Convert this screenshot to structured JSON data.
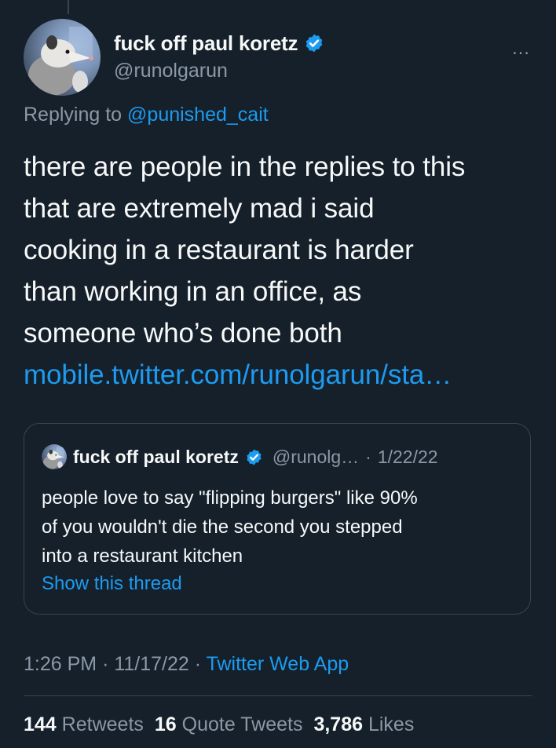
{
  "author": {
    "display_name": "fuck off paul koretz",
    "handle": "@runolgarun",
    "verified": true,
    "avatar_icon": "opossum-avatar"
  },
  "more_icon": "…",
  "replying_to": {
    "prefix": "Replying to",
    "mention": "@punished_cait"
  },
  "tweet": {
    "lines": [
      "there are people in the replies to this",
      "that are extremely mad i said",
      "cooking in a restaurant is harder",
      "than working in an office, as",
      "someone who’s done both"
    ],
    "link": "mobile.twitter.com/runolgarun/sta…"
  },
  "quote_tweet": {
    "display_name": "fuck off paul koretz",
    "handle": "@runolg…",
    "separator": "·",
    "date": "1/22/22",
    "lines": [
      "people love to say \"flipping burgers\" like 90%",
      "of you wouldn't die the second you stepped",
      "into a restaurant kitchen"
    ],
    "show_thread": "Show this thread"
  },
  "meta": {
    "time": "1:26 PM",
    "date": "11/17/22",
    "source": "Twitter Web App",
    "separator": "·"
  },
  "stats": {
    "retweets_count": "144",
    "retweets_label": "Retweets",
    "quotes_count": "16",
    "quotes_label": "Quote Tweets",
    "likes_count": "3,786",
    "likes_label": "Likes"
  },
  "colors": {
    "background": "#15202b",
    "text": "#f7f9f9",
    "secondary": "#8b98a5",
    "accent": "#1d9bf0",
    "border": "#38444d"
  }
}
